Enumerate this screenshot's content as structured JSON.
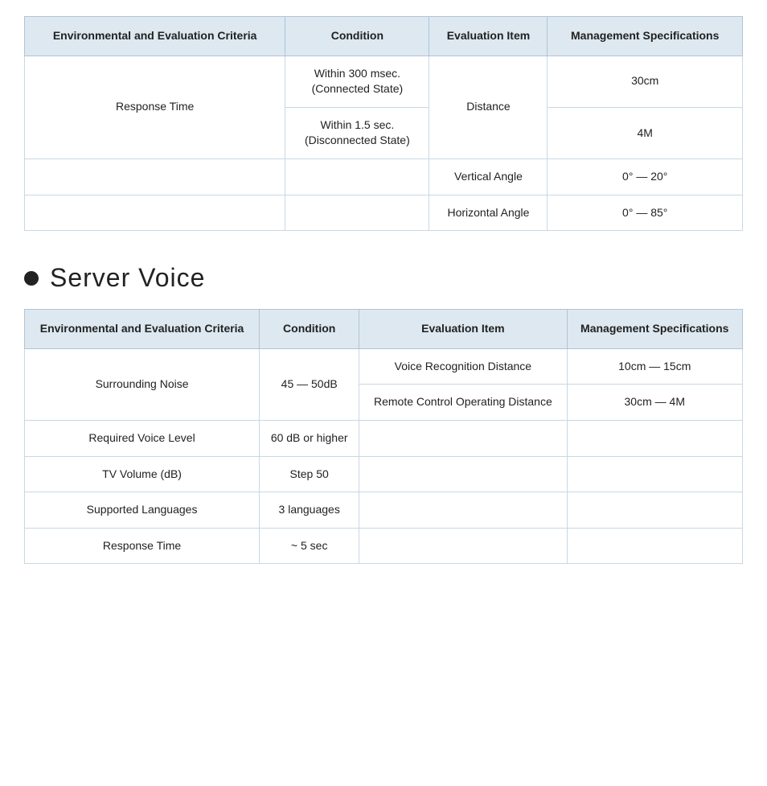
{
  "table1": {
    "headers": [
      "Environmental and Evaluation Criteria",
      "Condition",
      "Evaluation Item",
      "Management Specifications"
    ],
    "rows": [
      {
        "criteria": "Response Time",
        "condition": "Within 300 msec.\n(Connected State)",
        "item": "Distance",
        "spec": "30cm"
      },
      {
        "criteria": "",
        "condition": "Within 1.5 sec.\n(Disconnected State)",
        "item": "",
        "spec": "4M"
      },
      {
        "criteria": "",
        "condition": "",
        "item": "Vertical Angle",
        "spec": "0° — 20°"
      },
      {
        "criteria": "",
        "condition": "",
        "item": "Horizontal Angle",
        "spec": "0° — 85°"
      }
    ]
  },
  "section": {
    "bullet": "•",
    "title": "Server Voice"
  },
  "table2": {
    "headers": [
      "Environmental and Evaluation Criteria",
      "Condition",
      "Evaluation Item",
      "Management Specifications"
    ],
    "rows": [
      {
        "criteria": "Surrounding Noise",
        "condition": "45 — 50dB",
        "item": "Voice Recognition Distance",
        "spec": "10cm — 15cm"
      },
      {
        "criteria": "",
        "condition": "",
        "item": "Remote Control Operating Distance",
        "spec": "30cm — 4M"
      },
      {
        "criteria": "Required Voice Level",
        "condition": "60 dB or higher",
        "item": "",
        "spec": ""
      },
      {
        "criteria": "TV Volume (dB)",
        "condition": "Step 50",
        "item": "",
        "spec": ""
      },
      {
        "criteria": "Supported Languages",
        "condition": "3 languages",
        "item": "",
        "spec": ""
      },
      {
        "criteria": "Response Time",
        "condition": "~ 5 sec",
        "item": "",
        "spec": ""
      }
    ]
  }
}
